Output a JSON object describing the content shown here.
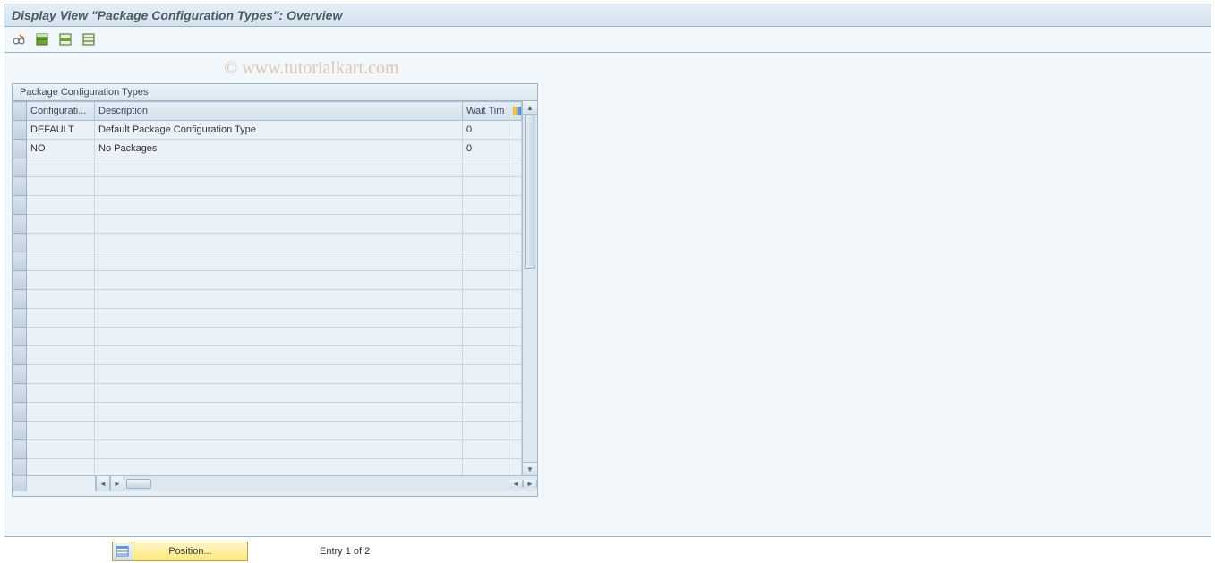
{
  "header": {
    "title": "Display View \"Package Configuration Types\": Overview"
  },
  "watermark": "© www.tutorialkart.com",
  "table": {
    "title": "Package Configuration Types",
    "columns": {
      "configuration": "Configurati...",
      "description": "Description",
      "wait_time": "Wait Tim"
    },
    "rows": [
      {
        "configuration": "DEFAULT",
        "description": "Default Package Configuration Type",
        "wait_time": "0"
      },
      {
        "configuration": "NO",
        "description": "No Packages",
        "wait_time": "0"
      }
    ]
  },
  "footer": {
    "position_label": "Position...",
    "entry_text": "Entry 1 of 2"
  }
}
